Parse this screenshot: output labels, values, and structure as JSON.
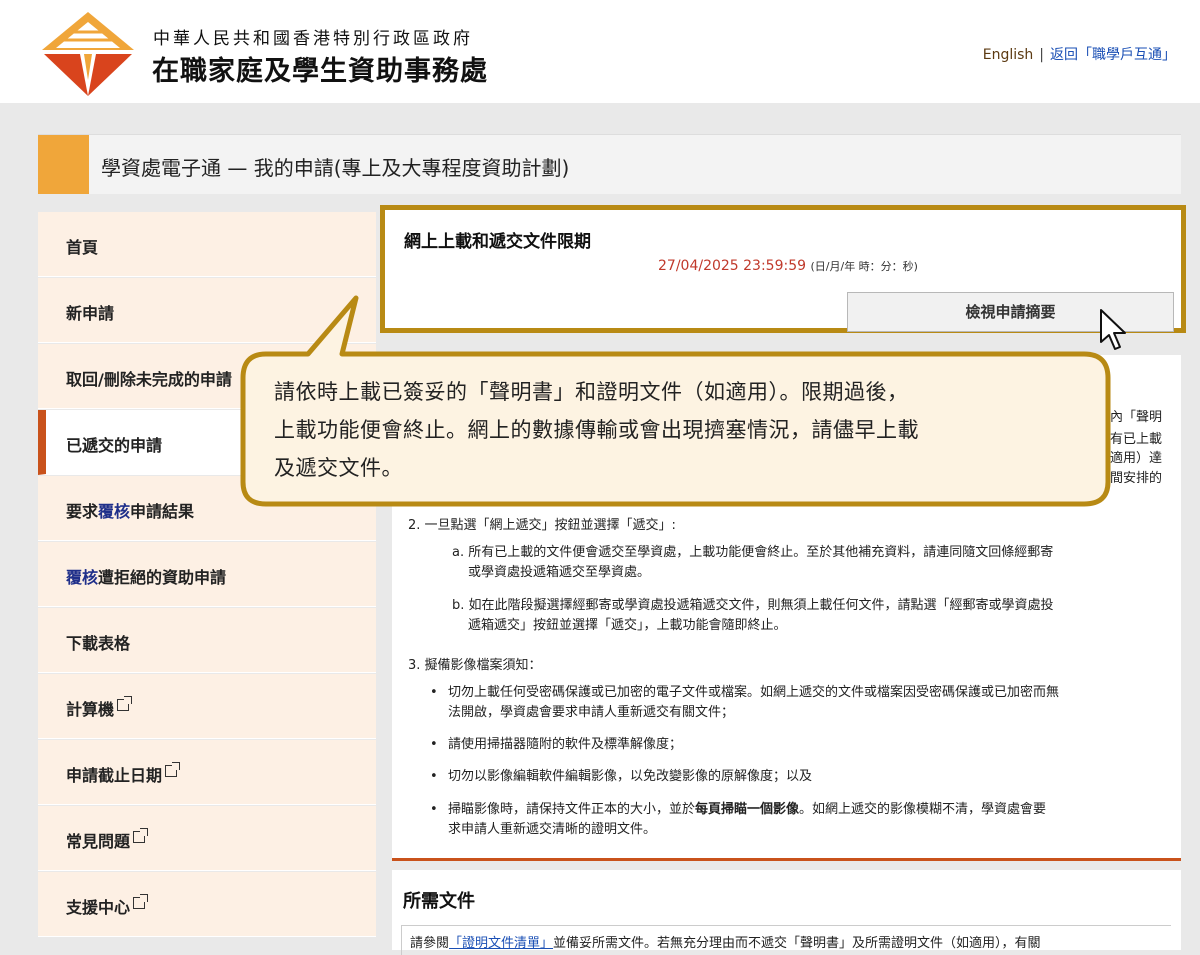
{
  "header": {
    "org_line1": "中華人民共和國香港特別行政區政府",
    "org_line2": "在職家庭及學生資助事務處",
    "english_link": "English",
    "separator": "|",
    "back_link": "返回「職學戶互通」"
  },
  "title_bar": {
    "title": "學資處電子通 — 我的申請(專上及大專程度資助計劃)"
  },
  "sidebar": {
    "items": [
      {
        "label": "首頁"
      },
      {
        "label": "新申請"
      },
      {
        "label": "取回/刪除未完成的申請"
      },
      {
        "label": "已遞交的申請"
      },
      {
        "label_pre": "要求",
        "label_hl": "覆核",
        "label_post": "申請結果"
      },
      {
        "label_hl": "覆核",
        "label_post": "遭拒絕的資助申請"
      },
      {
        "label": "下載表格"
      },
      {
        "label": "計算機"
      },
      {
        "label": "申請截止日期"
      },
      {
        "label": "常見問題"
      },
      {
        "label": "支援中心"
      }
    ]
  },
  "deadline": {
    "heading": "網上上載和遞交文件限期",
    "date": "27/04/2025 23:59:59",
    "date_format": "(日/月/年 時：分：秒)",
    "view_button": "檢視申請摘要"
  },
  "callout": {
    "line1": "請依時上載已簽妥的「聲明書」和證明文件（如適用）。限期過後，",
    "line2": "上載功能便會終止。網上的數據傳輸或會出現擠塞情況，請儘早上載",
    "line3": "及遞交文件。"
  },
  "partial_right": {
    "r1": "內「聲明",
    "r2": "有已上載",
    "r3": "適用）達",
    "r4": "間安排的"
  },
  "instructions": {
    "item2_title": "2. 一旦點選「網上遞交」按鈕並選擇「遞交」:",
    "item2a_l1": "a. 所有已上載的文件便會遞交至學資處，上載功能便會終止。至於其他補充資料，請連同隨文回條經郵寄",
    "item2a_l2": "或學資處投遞箱遞交至學資處。",
    "item2b_l1": "b. 如在此階段擬選擇經郵寄或學資處投遞箱遞交文件，則無須上載任何文件，請點選「經郵寄或學資處投",
    "item2b_l2": "遞箱遞交」按鈕並選擇「遞交」，上載功能會隨即終止。",
    "item3_title": "3. 擬備影像檔案須知：",
    "bullet1_l1": "切勿上載任何受密碼保護或已加密的電子文件或檔案。如網上遞交的文件或檔案因受密碼保護或已加密而無",
    "bullet1_l2": "法開啟，學資處會要求申請人重新遞交有關文件；",
    "bullet2": "請使用掃描器隨附的軟件及標準解像度；",
    "bullet3": "切勿以影像編輯軟件編輯影像，以免改變影像的原解像度；以及",
    "bullet4_pre": "掃瞄影像時，請保持文件正本的大小，並於",
    "bullet4_bold": "每頁掃瞄一個影像",
    "bullet4_post": "。如網上遞交的影像模糊不清，學資處會要",
    "bullet4_l2": "求申請人重新遞交清晰的證明文件。"
  },
  "docs": {
    "heading": "所需文件",
    "text_pre": "請參閱",
    "link": "「證明文件清單」",
    "text_post": "並備妥所需文件。若無充分理由而不遞交「聲明書」及所需證明文件（如適用），有關"
  },
  "colors": {
    "accent_orange": "#f0a63a",
    "active_red": "#c9521b",
    "callout_gold": "#b88a14",
    "callout_fill": "#fdf3e2",
    "sidebar_bg": "#fdf0e4",
    "date_red": "#c0392b"
  }
}
